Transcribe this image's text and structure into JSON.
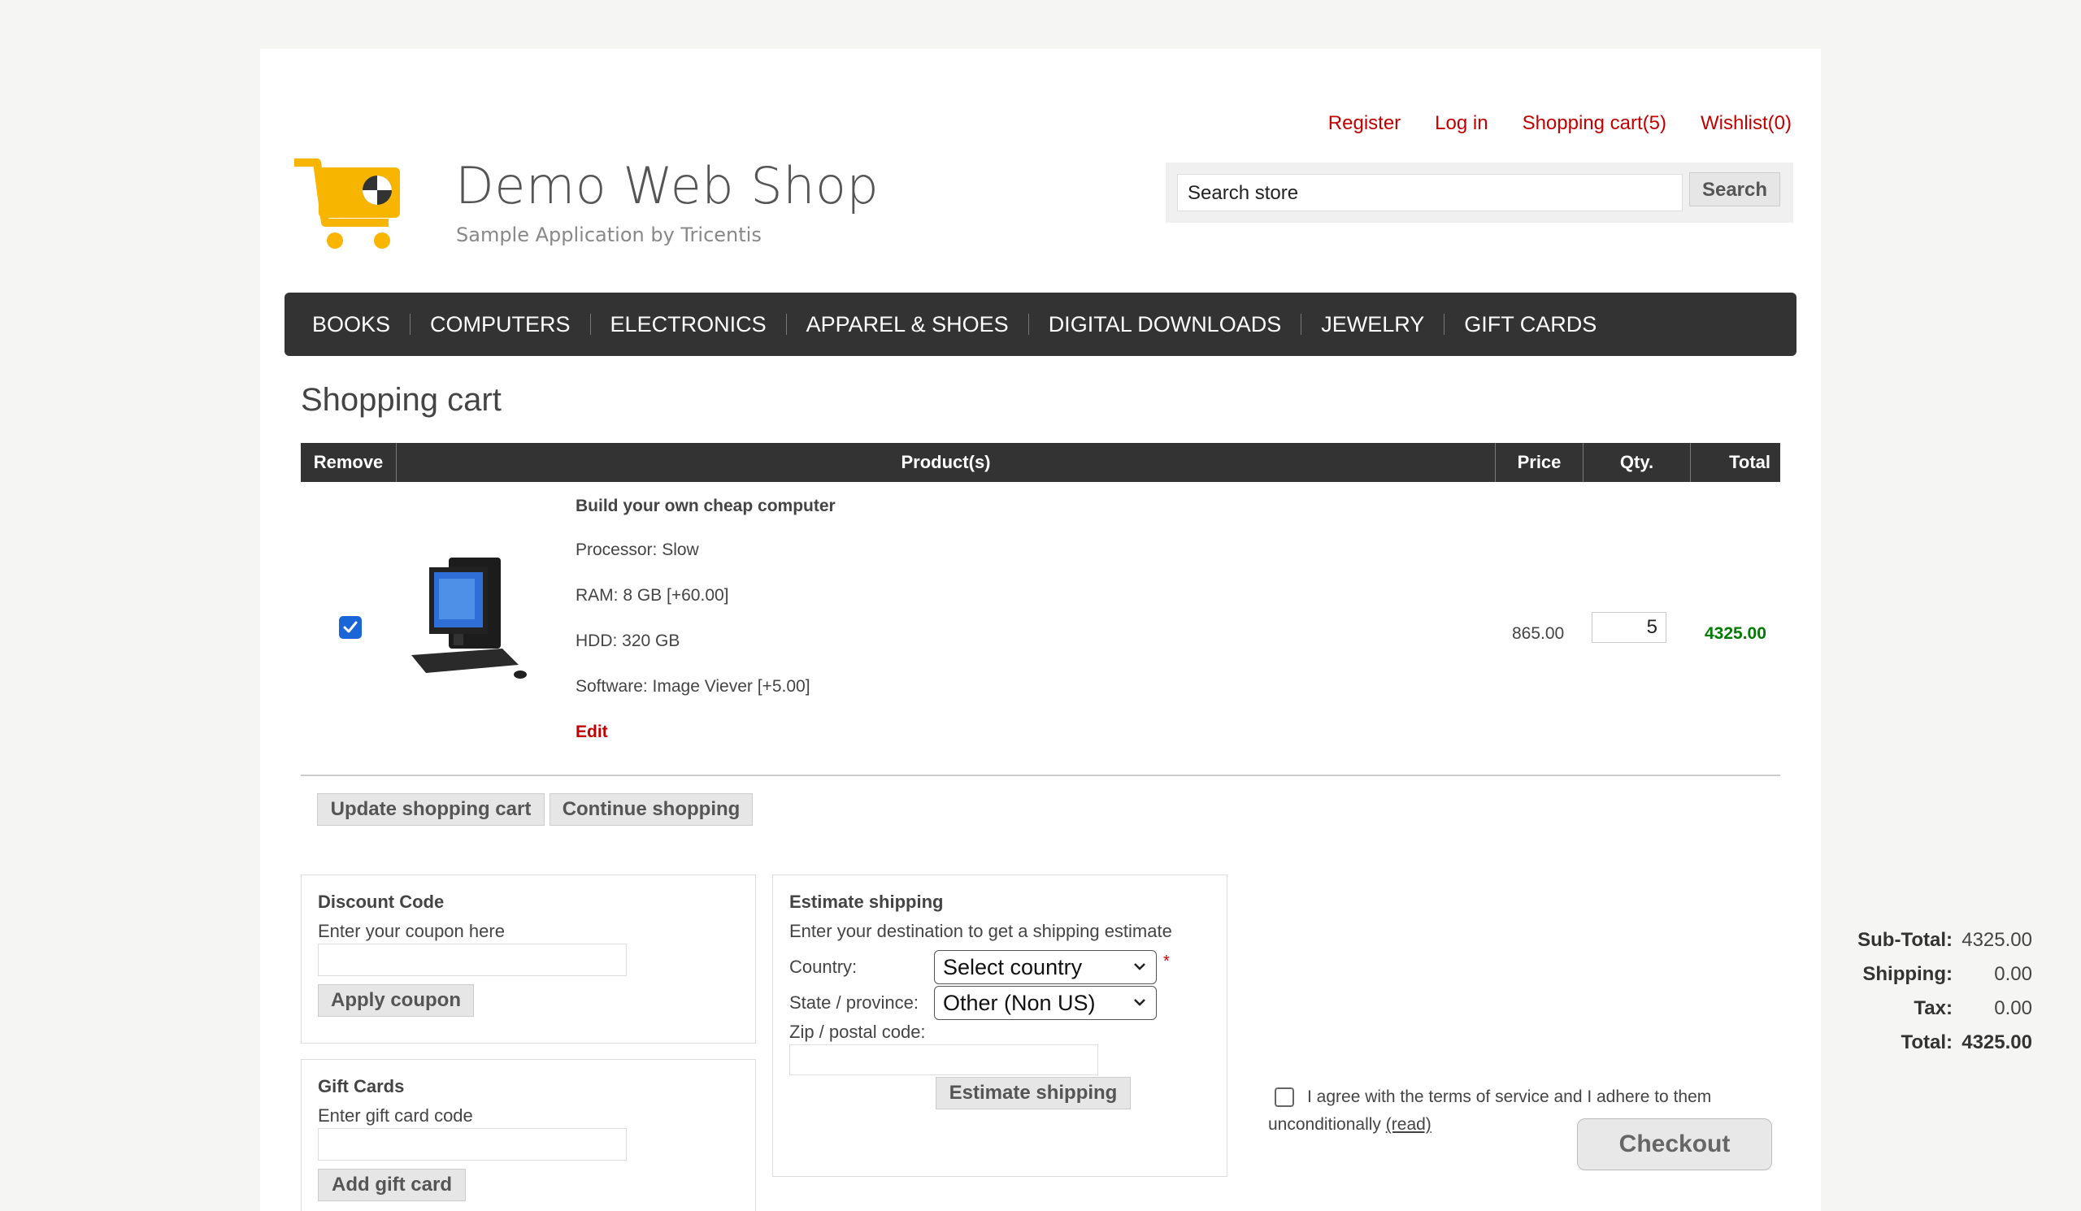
{
  "brand": {
    "title": "Demo Web Shop",
    "subtitle": "Sample Application by Tricentis"
  },
  "header": {
    "links": {
      "register": "Register",
      "login": "Log in",
      "cart": "Shopping cart(5)",
      "wishlist": "Wishlist(0)"
    },
    "search": {
      "value": "Search store",
      "button": "Search"
    }
  },
  "nav": {
    "items": [
      "BOOKS",
      "COMPUTERS",
      "ELECTRONICS",
      "APPAREL & SHOES",
      "DIGITAL DOWNLOADS",
      "JEWELRY",
      "GIFT CARDS"
    ]
  },
  "page_title": "Shopping cart",
  "cart": {
    "columns": {
      "remove": "Remove",
      "product": "Product(s)",
      "price": "Price",
      "qty": "Qty.",
      "total": "Total"
    },
    "items": [
      {
        "name": "Build your own cheap computer",
        "attributes": [
          "Processor: Slow",
          "RAM: 8 GB [+60.00]",
          "HDD: 320 GB",
          "Software: Image Viever [+5.00]"
        ],
        "edit": "Edit",
        "price": "865.00",
        "qty": "5",
        "total": "4325.00",
        "remove_checked": true
      }
    ],
    "update_button": "Update shopping cart",
    "continue_button": "Continue shopping"
  },
  "discount": {
    "title": "Discount Code",
    "hint": "Enter your coupon here",
    "button": "Apply coupon"
  },
  "giftcards": {
    "title": "Gift Cards",
    "hint": "Enter gift card code",
    "button": "Add gift card"
  },
  "shipping": {
    "title": "Estimate shipping",
    "hint": "Enter your destination to get a shipping estimate",
    "country_label": "Country:",
    "country_value": "Select country",
    "state_label": "State / province:",
    "state_value": "Other (Non US)",
    "zip_label": "Zip / postal code:",
    "button": "Estimate shipping"
  },
  "totals": {
    "subtotal_label": "Sub-Total:",
    "subtotal": "4325.00",
    "shipping_label": "Shipping:",
    "shipping": "0.00",
    "tax_label": "Tax:",
    "tax": "0.00",
    "total_label": "Total:",
    "total": "4325.00"
  },
  "terms": {
    "text": "I agree with the terms of service and I adhere to them unconditionally",
    "read": "(read)"
  },
  "checkout_button": "Checkout",
  "colors": {
    "link_red": "#c20000",
    "nav_bg": "#333333",
    "total_green": "#007a00",
    "logo_orange": "#f7b500"
  }
}
